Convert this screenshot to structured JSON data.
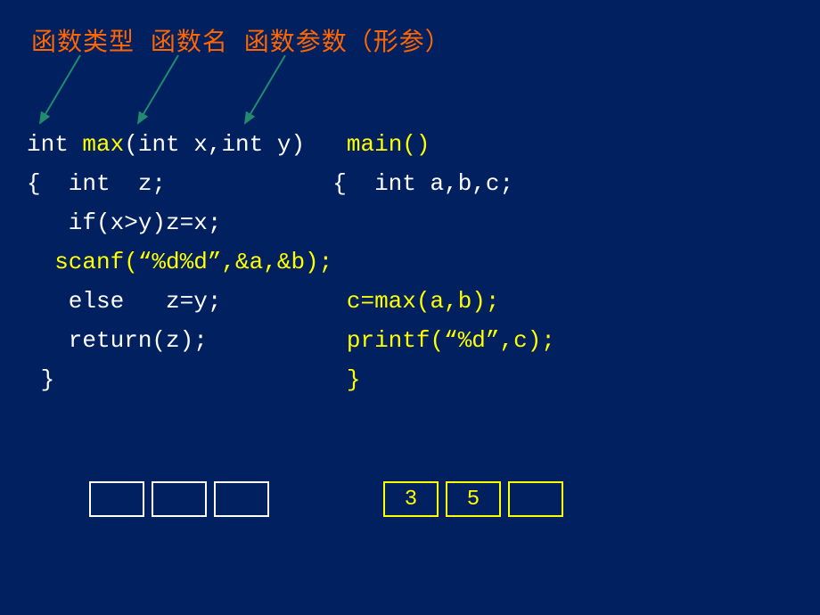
{
  "heading": {
    "label1": "函数类型",
    "label2": "函数名",
    "label3": "函数参数（形参）"
  },
  "code": {
    "line1_left_a": "int ",
    "line1_left_b": "max",
    "line1_left_c": "(int x,int y)",
    "line1_right": "main()",
    "line2_left": "{  int  z;",
    "line2_right": "{  int a,b,c;    ",
    "line3": "   if(x>y)z=x;",
    "line4": "  scanf(“%d%d”,&a,&b);",
    "line5_left": "   else   z=y;",
    "line5_right": "c=max(a,b);",
    "line6_left": "   return(z);",
    "line6_right": "printf(“%d”,c);",
    "line7_left": " }",
    "line7_right": "}"
  },
  "boxes": {
    "left": [
      "",
      "",
      ""
    ],
    "right": [
      "3",
      "5",
      ""
    ]
  }
}
